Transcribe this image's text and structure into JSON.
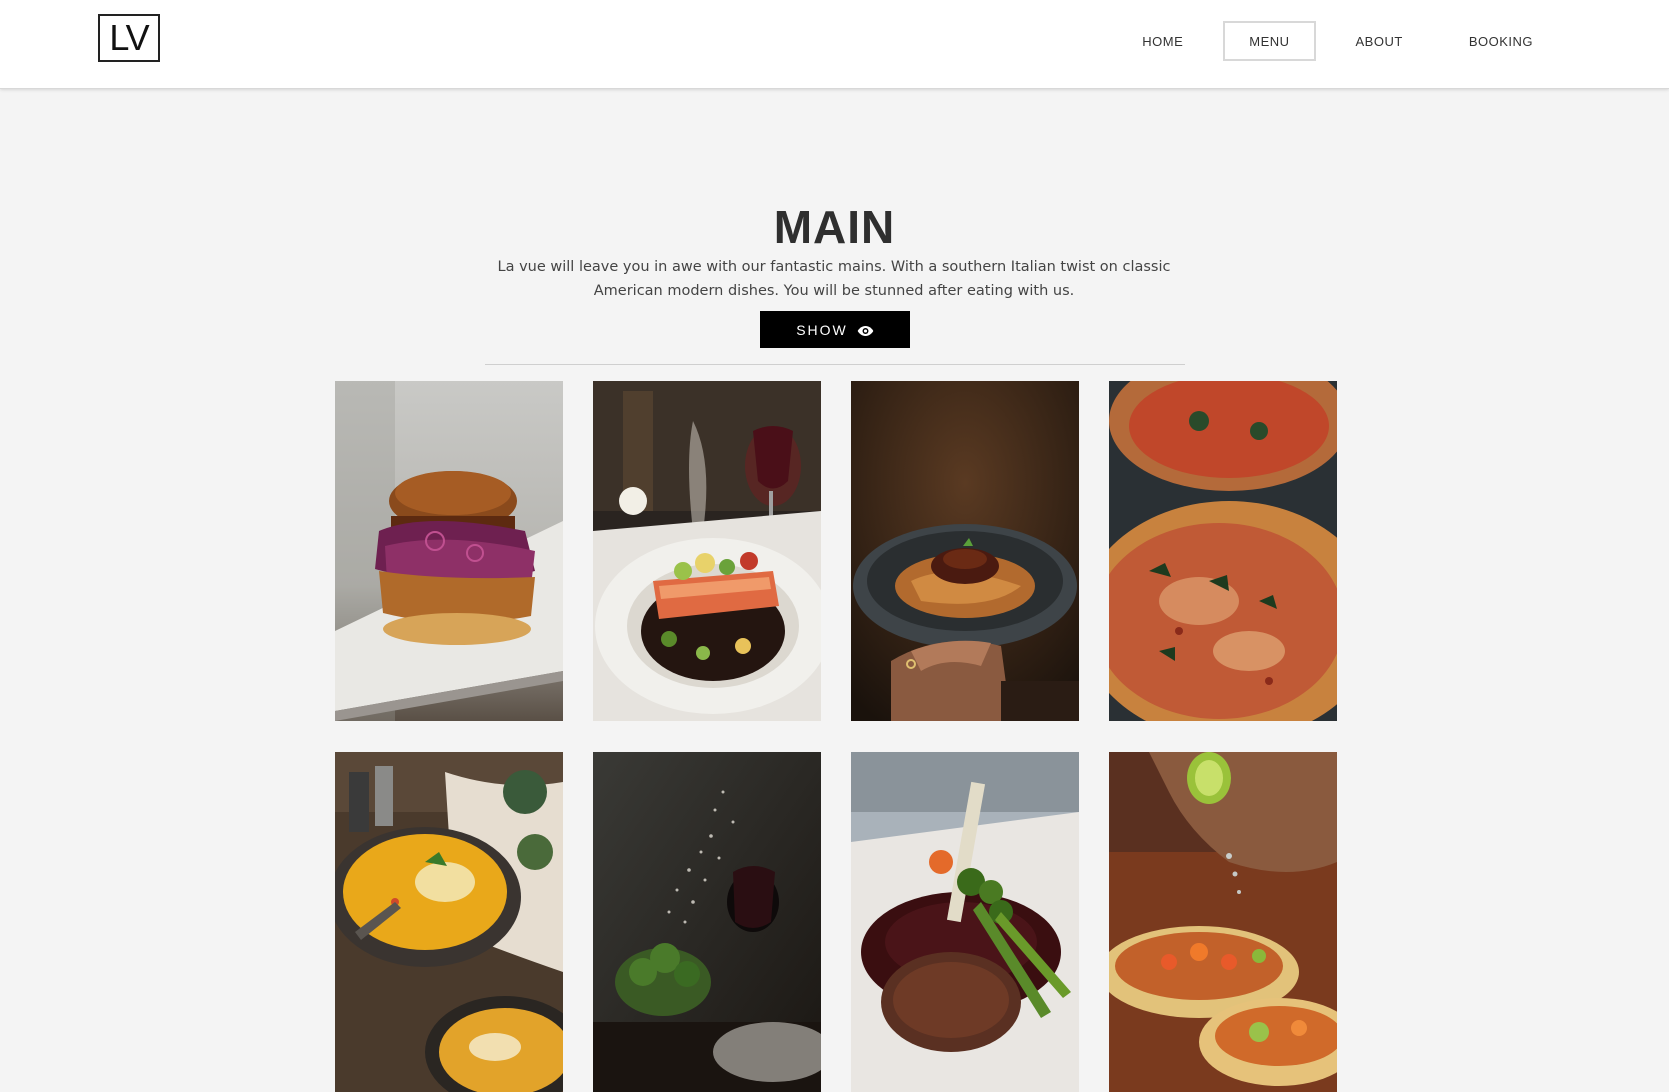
{
  "header": {
    "logo_text": "LV",
    "nav": [
      {
        "label": "HOME",
        "active": false
      },
      {
        "label": "MENU",
        "active": true
      },
      {
        "label": "ABOUT",
        "active": false
      },
      {
        "label": "BOOKING",
        "active": false
      }
    ]
  },
  "section": {
    "title": "MAIN",
    "description": "La vue will leave you in awe with our fantastic mains. With a southern Italian twist on classic American modern dishes. You will be stunned after eating with us.",
    "show_label": "SHOW",
    "show_icon": "eye-icon"
  },
  "gallery": {
    "items": [
      {
        "name": "burger-photo"
      },
      {
        "name": "salmon-plate-photo"
      },
      {
        "name": "spaghetti-bowl-photo"
      },
      {
        "name": "pizza-photo"
      },
      {
        "name": "curry-soup-photo"
      },
      {
        "name": "broccoli-salt-photo"
      },
      {
        "name": "steak-photo"
      },
      {
        "name": "tacos-lime-photo"
      }
    ]
  }
}
